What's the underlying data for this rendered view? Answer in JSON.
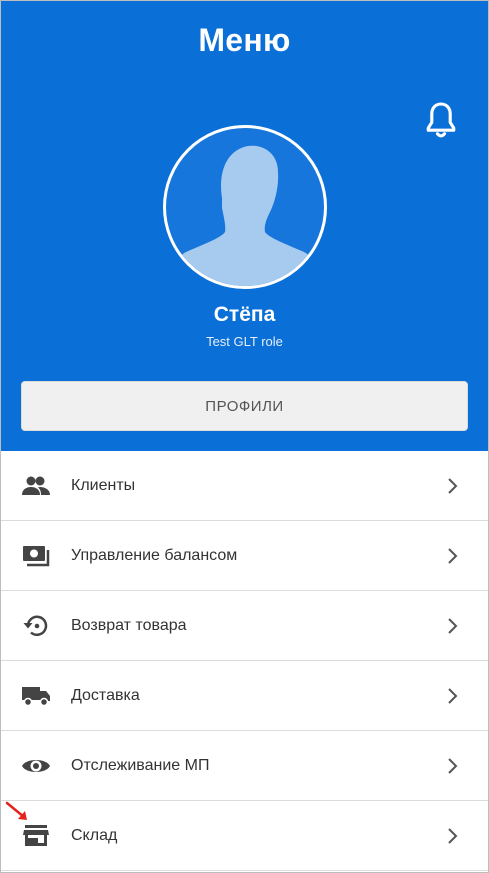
{
  "app_bar": {
    "title": "Меню"
  },
  "profile": {
    "name": "Стёпа",
    "role": "Test GLT role",
    "profiles_button": "ПРОФИЛИ"
  },
  "menu": {
    "items": [
      {
        "label": "Клиенты",
        "icon": "people-icon"
      },
      {
        "label": "Управление балансом",
        "icon": "money-icon"
      },
      {
        "label": "Возврат товара",
        "icon": "return-icon"
      },
      {
        "label": "Доставка",
        "icon": "truck-icon"
      },
      {
        "label": "Отслеживание МП",
        "icon": "eye-icon"
      },
      {
        "label": "Склад",
        "icon": "store-icon"
      }
    ]
  },
  "colors": {
    "primary": "#0a6fd6",
    "avatar_silhouette": "#a7cbee",
    "icon": "#444444",
    "annotation_arrow": "#e3231c"
  }
}
